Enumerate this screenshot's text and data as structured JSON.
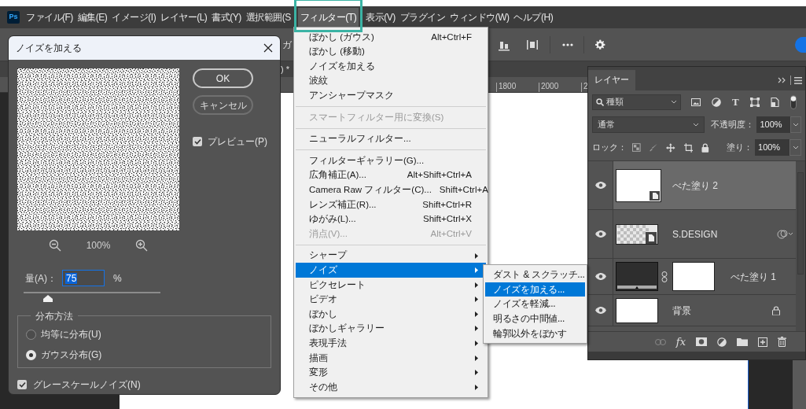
{
  "app": {
    "logo": "Ps"
  },
  "menubar": {
    "items": [
      {
        "label": "ファイル(F)",
        "selected": false
      },
      {
        "label": "編集(E)",
        "selected": false
      },
      {
        "label": "イメージ(I)",
        "selected": false
      },
      {
        "label": "レイヤー(L)",
        "selected": false
      },
      {
        "label": "書式(Y)",
        "selected": false
      },
      {
        "label": "選択範囲(S",
        "selected": false
      },
      {
        "label": "フィルター(T)",
        "selected": true
      },
      {
        "label": "表示(V)",
        "selected": false
      },
      {
        "label": "プラグイン",
        "selected": false
      },
      {
        "label": "ウィンドウ(W)",
        "selected": false
      },
      {
        "label": "ヘルプ(H)",
        "selected": false
      }
    ]
  },
  "toolbar": {
    "text": "ガ"
  },
  "document_tab": {
    "title": ") *"
  },
  "ruler": {
    "labels": [
      "1800",
      "2000",
      "2"
    ]
  },
  "dialog": {
    "title": "ノイズを加える",
    "zoom": "100%",
    "buttons": [
      "OK",
      "キャンセル"
    ],
    "preview": {
      "label": "プレビュー(P)",
      "checked": true
    },
    "amount": {
      "label": "量(A)：",
      "value": "75",
      "unit": "%",
      "level": 0.18
    },
    "distribution": {
      "legend": "分布方法",
      "options": [
        {
          "label": "均等に分布(U)",
          "selected": false
        },
        {
          "label": "ガウス分布(G)",
          "selected": true
        }
      ]
    },
    "grayscale": {
      "label": "グレースケールノイズ(N)",
      "checked": true
    }
  },
  "filter_menu": {
    "items": [
      {
        "kind": "item",
        "label": "ぼかし (ガウス)",
        "shortcut": "Alt+Ctrl+F",
        "disabled": false,
        "selected": false
      },
      {
        "kind": "item",
        "label": "ぼかし (移動)",
        "disabled": false,
        "selected": false
      },
      {
        "kind": "item",
        "label": "ノイズを加える",
        "disabled": false,
        "selected": false
      },
      {
        "kind": "item",
        "label": "波紋",
        "disabled": false,
        "selected": false
      },
      {
        "kind": "item",
        "label": "アンシャープマスク",
        "disabled": false,
        "selected": false
      },
      {
        "kind": "separator"
      },
      {
        "kind": "item",
        "label": "スマートフィルター用に変換(S)",
        "disabled": true,
        "selected": false
      },
      {
        "kind": "separator"
      },
      {
        "kind": "item",
        "label": "ニューラルフィルター...",
        "disabled": false,
        "selected": false
      },
      {
        "kind": "separator"
      },
      {
        "kind": "item",
        "label": "フィルターギャラリー(G)...",
        "disabled": false,
        "selected": false
      },
      {
        "kind": "item",
        "label": "広角補正(A)...",
        "shortcut": "Alt+Shift+Ctrl+A",
        "disabled": false,
        "selected": false
      },
      {
        "kind": "item",
        "label": "Camera Raw フィルター(C)...",
        "shortcut": "Shift+Ctrl+A",
        "disabled": false,
        "selected": false
      },
      {
        "kind": "item",
        "label": "レンズ補正(R)...",
        "shortcut": "Shift+Ctrl+R",
        "disabled": false,
        "selected": false
      },
      {
        "kind": "item",
        "label": "ゆがみ(L)...",
        "shortcut": "Shift+Ctrl+X",
        "disabled": false,
        "selected": false
      },
      {
        "kind": "item",
        "label": "消点(V)...",
        "shortcut": "Alt+Ctrl+V",
        "disabled": true,
        "selected": false
      },
      {
        "kind": "separator"
      },
      {
        "kind": "submenu",
        "label": "シャープ",
        "disabled": false,
        "selected": false
      },
      {
        "kind": "submenu",
        "label": "ノイズ",
        "disabled": false,
        "selected": true
      },
      {
        "kind": "submenu",
        "label": "ピクセレート",
        "disabled": false,
        "selected": false
      },
      {
        "kind": "submenu",
        "label": "ビデオ",
        "disabled": false,
        "selected": false
      },
      {
        "kind": "submenu",
        "label": "ぼかし",
        "disabled": false,
        "selected": false
      },
      {
        "kind": "submenu",
        "label": "ぼかしギャラリー",
        "disabled": false,
        "selected": false
      },
      {
        "kind": "submenu",
        "label": "表現手法",
        "disabled": false,
        "selected": false
      },
      {
        "kind": "submenu",
        "label": "描画",
        "disabled": false,
        "selected": false
      },
      {
        "kind": "submenu",
        "label": "変形",
        "disabled": false,
        "selected": false
      },
      {
        "kind": "submenu",
        "label": "その他",
        "disabled": false,
        "selected": false
      }
    ]
  },
  "noise_submenu": {
    "items": [
      {
        "label": "ダスト & スクラッチ...",
        "selected": false
      },
      {
        "label": "ノイズを加える...",
        "selected": true
      },
      {
        "label": "ノイズを軽減...",
        "selected": false
      },
      {
        "label": "明るさの中間値...",
        "selected": false
      },
      {
        "label": "輪郭以外をぼかす",
        "selected": false
      }
    ]
  },
  "layers_panel": {
    "tabs": [
      {
        "label": "レイヤー",
        "selected": true
      }
    ],
    "filter": "種類",
    "type_filter": "T",
    "blend_mode": "通常",
    "opacity_label": "不透明度：",
    "opacity": "100%",
    "lock_label": "ロック：",
    "fill_label": "塗り：",
    "fill": "100%",
    "effects_label": "fx",
    "layers": [
      {
        "name": "べた塗り 2",
        "kind": "smart",
        "selected": true,
        "visible": true,
        "locked": false
      },
      {
        "name": "S.DESIGN",
        "kind": "pattern",
        "selected": false,
        "visible": true,
        "locked": false
      },
      {
        "name": "べた塗り 1",
        "kind": "fill",
        "selected": false,
        "visible": true,
        "locked": false
      },
      {
        "name": "背景",
        "kind": "background",
        "selected": false,
        "visible": true,
        "locked": true
      }
    ]
  }
}
